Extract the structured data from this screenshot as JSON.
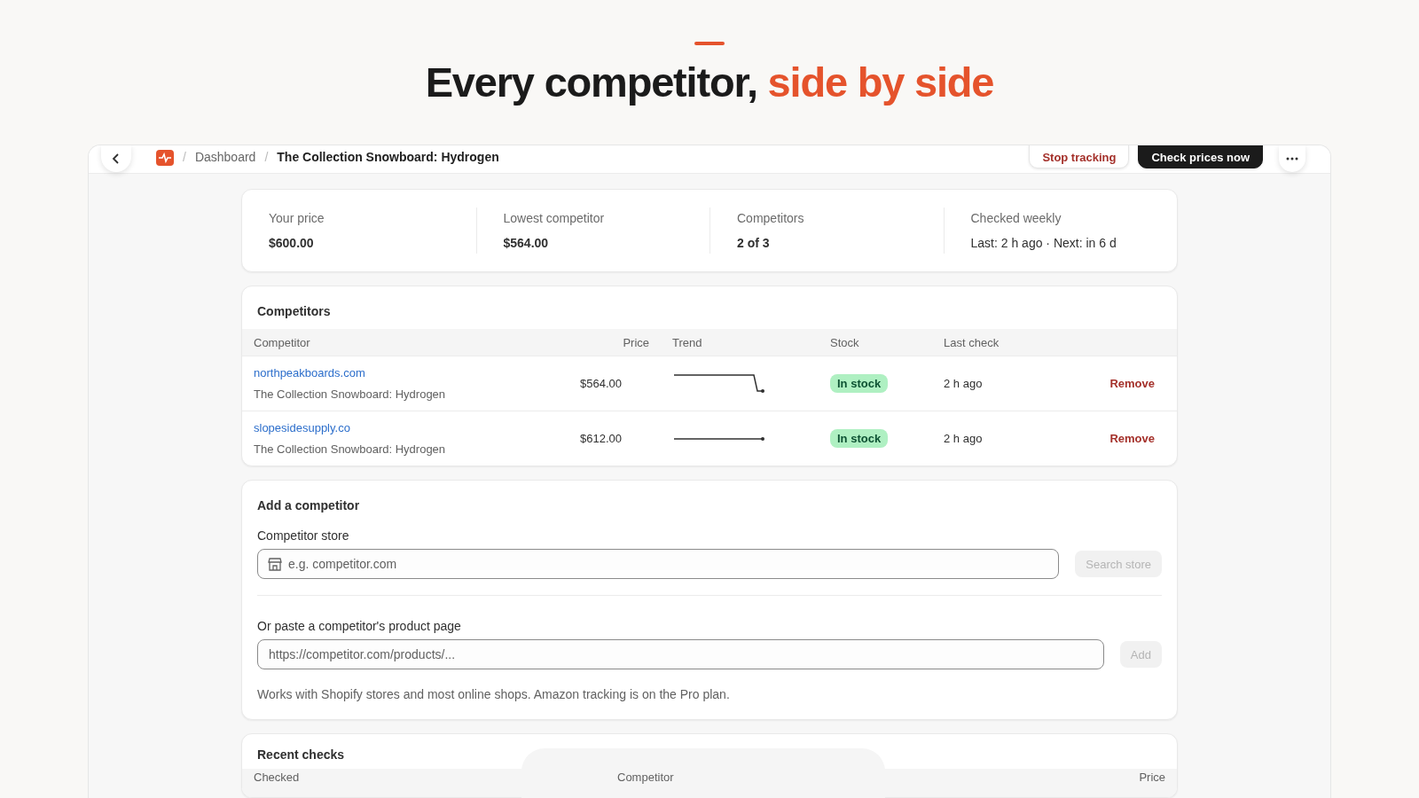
{
  "headline": {
    "text": "Every competitor, ",
    "accent": "side by side"
  },
  "topbar": {
    "separator": "/",
    "breadcrumbs": [
      {
        "label": "Dashboard",
        "current": false
      },
      {
        "label": "The Collection Snowboard: Hydrogen",
        "current": true
      }
    ],
    "actions": [
      {
        "label": "Stop tracking",
        "kind": "outline"
      },
      {
        "label": "Check prices now",
        "kind": "primary"
      }
    ]
  },
  "stats": [
    {
      "label": "Your price",
      "value": "$600.00",
      "bold": true
    },
    {
      "label": "Lowest competitor",
      "value": "$564.00",
      "bold": true
    },
    {
      "label": "Competitors",
      "value": "2 of 3",
      "bold": true
    },
    {
      "label": "Checked weekly",
      "value": "Last: 2 h ago · Next: in 6 d",
      "bold": false
    }
  ],
  "competitors": {
    "title": "Competitors",
    "columns": [
      "Competitor",
      "Price",
      "Trend",
      "Stock",
      "Last check"
    ],
    "rows": [
      {
        "store": "northpeakboards.com",
        "product": "The Collection Snowboard: Hydrogen",
        "price": "$564.00",
        "kind": "drop",
        "stock": "In stock",
        "last_check": "2 h ago",
        "action": "Remove"
      },
      {
        "store": "slopesidesupply.co",
        "product": "The Collection Snowboard: Hydrogen",
        "price": "$612.00",
        "kind": "flat",
        "stock": "In stock",
        "last_check": "2 h ago",
        "action": "Remove"
      }
    ]
  },
  "add_competitor": {
    "title": "Add a competitor",
    "store_field": {
      "label": "Competitor store",
      "placeholder": "e.g. competitor.com",
      "button": "Search store",
      "disabled": true
    },
    "url_field": {
      "label": "Or paste a competitor's product page",
      "placeholder": "https://competitor.com/products/...",
      "button": "Add",
      "disabled": true
    },
    "note": "Works with Shopify stores and most online shops. Amazon tracking is on the Pro plan."
  },
  "recent_checks": {
    "title": "Recent checks",
    "columns": [
      "Checked",
      "Competitor",
      "Price"
    ]
  }
}
